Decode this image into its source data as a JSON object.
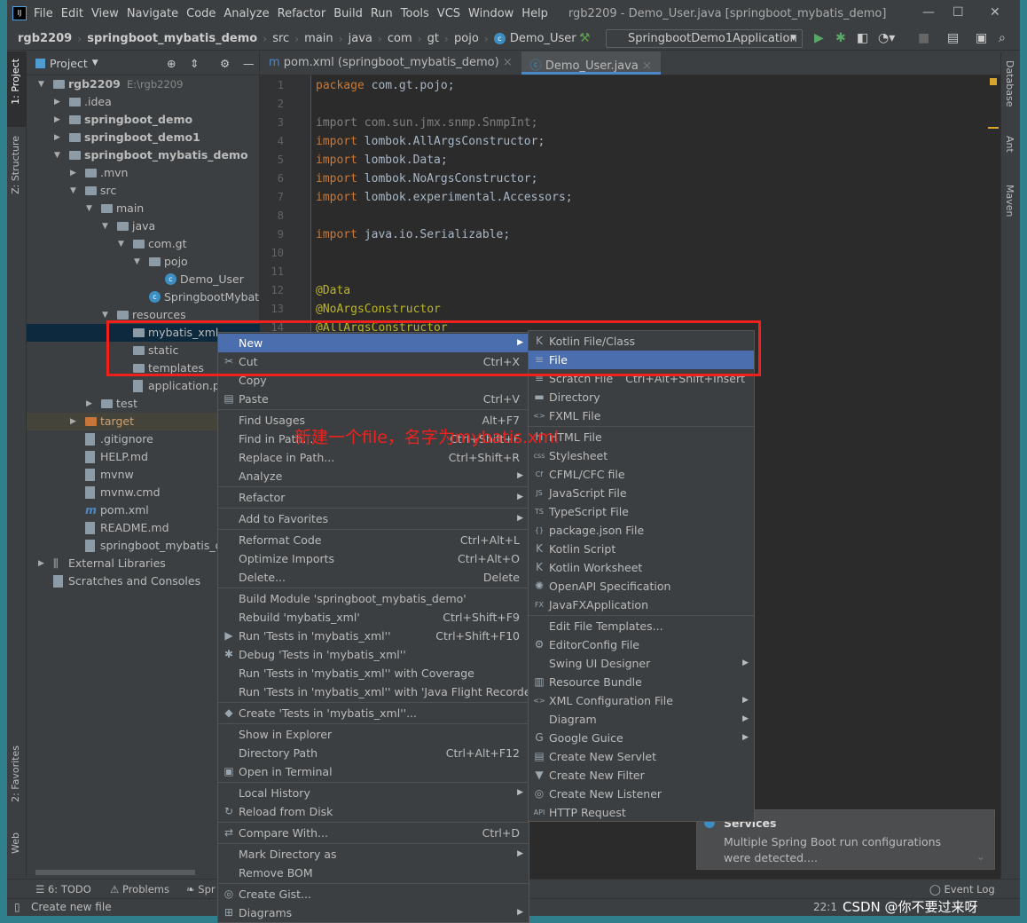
{
  "app": {
    "title": "rgb2209 - Demo_User.java [springboot_mybatis_demo]",
    "logo": "IJ",
    "menu": [
      "File",
      "Edit",
      "View",
      "Navigate",
      "Code",
      "Analyze",
      "Refactor",
      "Build",
      "Run",
      "Tools",
      "VCS",
      "Window",
      "Help"
    ]
  },
  "navbar": {
    "crumbs": [
      "rgb2209",
      "springboot_mybatis_demo",
      "src",
      "main",
      "java",
      "com",
      "gt",
      "pojo",
      "Demo_User"
    ],
    "run_config": "SpringbootDemo1Application"
  },
  "left_strip": [
    "1: Project",
    "Z: Structure",
    "2: Favorites",
    "Web"
  ],
  "right_strip": [
    "Database",
    "Ant",
    "Maven"
  ],
  "project": {
    "title": "Project",
    "tree": [
      {
        "label": "rgb2209",
        "hint": "E:\\rgb2209",
        "level": 0,
        "arrow": "open",
        "icon": "folder",
        "bold": true
      },
      {
        "label": ".idea",
        "level": 1,
        "arrow": "closed",
        "icon": "folder"
      },
      {
        "label": "springboot_demo",
        "level": 1,
        "arrow": "closed",
        "icon": "folder",
        "bold": true
      },
      {
        "label": "springboot_demo1",
        "level": 1,
        "arrow": "closed",
        "icon": "folder",
        "bold": true
      },
      {
        "label": "springboot_mybatis_demo",
        "level": 1,
        "arrow": "open",
        "icon": "folder",
        "bold": true
      },
      {
        "label": ".mvn",
        "level": 2,
        "arrow": "closed",
        "icon": "folder"
      },
      {
        "label": "src",
        "level": 2,
        "arrow": "open",
        "icon": "folder"
      },
      {
        "label": "main",
        "level": 3,
        "arrow": "open",
        "icon": "folder"
      },
      {
        "label": "java",
        "level": 4,
        "arrow": "open",
        "icon": "folder"
      },
      {
        "label": "com.gt",
        "level": 5,
        "arrow": "open",
        "icon": "folder"
      },
      {
        "label": "pojo",
        "level": 6,
        "arrow": "open",
        "icon": "folder"
      },
      {
        "label": "Demo_User",
        "level": 7,
        "icon": "class"
      },
      {
        "label": "SpringbootMybatisD",
        "level": 6,
        "icon": "class"
      },
      {
        "label": "resources",
        "level": 4,
        "arrow": "open",
        "icon": "folder"
      },
      {
        "label": "mybatis_xml",
        "level": 5,
        "icon": "folder",
        "selected": true
      },
      {
        "label": "static",
        "level": 5,
        "icon": "folder"
      },
      {
        "label": "templates",
        "level": 5,
        "icon": "folder"
      },
      {
        "label": "application.pro",
        "level": 5,
        "icon": "file"
      },
      {
        "label": "test",
        "level": 3,
        "arrow": "closed",
        "icon": "folder"
      },
      {
        "label": "target",
        "level": 2,
        "arrow": "closed",
        "icon": "folder-orange",
        "excluded": true
      },
      {
        "label": ".gitignore",
        "level": 2,
        "icon": "file"
      },
      {
        "label": "HELP.md",
        "level": 2,
        "icon": "file"
      },
      {
        "label": "mvnw",
        "level": 2,
        "icon": "file"
      },
      {
        "label": "mvnw.cmd",
        "level": 2,
        "icon": "file"
      },
      {
        "label": "pom.xml",
        "level": 2,
        "icon": "maven"
      },
      {
        "label": "README.md",
        "level": 2,
        "icon": "file"
      },
      {
        "label": "springboot_mybatis_der",
        "level": 2,
        "icon": "file"
      },
      {
        "label": "External Libraries",
        "level": 0,
        "arrow": "closed",
        "icon": "library"
      },
      {
        "label": "Scratches and Consoles",
        "level": 0,
        "icon": "scratch"
      }
    ]
  },
  "editor": {
    "tabs": [
      {
        "label": "pom.xml (springboot_mybatis_demo)",
        "active": false
      },
      {
        "label": "Demo_User.java",
        "active": true
      }
    ],
    "lines": [
      [
        [
          "package",
          "kw"
        ],
        [
          " com.gt.pojo;",
          ""
        ]
      ],
      [],
      [
        [
          "import",
          "gr"
        ],
        [
          " com.sun.jmx.snmp.SnmpInt;",
          "gr"
        ]
      ],
      [
        [
          "import",
          "kw"
        ],
        [
          " lombok.AllArgsConstructor;",
          ""
        ]
      ],
      [
        [
          "import",
          "kw"
        ],
        [
          " lombok.Data;",
          ""
        ]
      ],
      [
        [
          "import",
          "kw"
        ],
        [
          " lombok.NoArgsConstructor;",
          ""
        ]
      ],
      [
        [
          "import",
          "kw"
        ],
        [
          " lombok.experimental.Accessors;",
          ""
        ]
      ],
      [],
      [
        [
          "import",
          "kw"
        ],
        [
          " java.io.Serializable;",
          ""
        ]
      ],
      [],
      [],
      [
        [
          "@Data",
          "an"
        ]
      ],
      [
        [
          "@NoArgsConstructor",
          "an"
        ]
      ],
      [
        [
          "@AllArgsConstructor",
          "an"
        ]
      ]
    ]
  },
  "context_menu": [
    {
      "label": "New",
      "sub": true,
      "hl": true
    },
    {
      "label": "Cut",
      "shortcut": "Ctrl+X",
      "icon": "✂"
    },
    {
      "label": "Copy"
    },
    {
      "label": "Paste",
      "shortcut": "Ctrl+V",
      "icon": "▤"
    },
    {
      "sep": true
    },
    {
      "label": "Find Usages",
      "shortcut": "Alt+F7"
    },
    {
      "label": "Find in Path...",
      "shortcut": "Ctrl+Shift+F"
    },
    {
      "label": "Replace in Path...",
      "shortcut": "Ctrl+Shift+R"
    },
    {
      "label": "Analyze",
      "sub": true
    },
    {
      "sep": true
    },
    {
      "label": "Refactor",
      "sub": true
    },
    {
      "sep": true
    },
    {
      "label": "Add to Favorites",
      "sub": true
    },
    {
      "sep": true
    },
    {
      "label": "Reformat Code",
      "shortcut": "Ctrl+Alt+L"
    },
    {
      "label": "Optimize Imports",
      "shortcut": "Ctrl+Alt+O"
    },
    {
      "label": "Delete...",
      "shortcut": "Delete"
    },
    {
      "sep": true
    },
    {
      "label": "Build Module 'springboot_mybatis_demo'"
    },
    {
      "label": "Rebuild 'mybatis_xml'",
      "shortcut": "Ctrl+Shift+F9"
    },
    {
      "label": "Run 'Tests in 'mybatis_xml''",
      "shortcut": "Ctrl+Shift+F10",
      "icon": "▶"
    },
    {
      "label": "Debug 'Tests in 'mybatis_xml''",
      "icon": "✱"
    },
    {
      "label": "Run 'Tests in 'mybatis_xml'' with Coverage"
    },
    {
      "label": "Run 'Tests in 'mybatis_xml'' with 'Java Flight Recorder'"
    },
    {
      "sep": true
    },
    {
      "label": "Create 'Tests in 'mybatis_xml''...",
      "icon": "◆"
    },
    {
      "sep": true
    },
    {
      "label": "Show in Explorer"
    },
    {
      "label": "Directory Path",
      "shortcut": "Ctrl+Alt+F12"
    },
    {
      "label": "Open in Terminal",
      "icon": "▣"
    },
    {
      "sep": true
    },
    {
      "label": "Local History",
      "sub": true
    },
    {
      "label": "Reload from Disk",
      "icon": "↻"
    },
    {
      "sep": true
    },
    {
      "label": "Compare With...",
      "shortcut": "Ctrl+D",
      "icon": "⇄"
    },
    {
      "sep": true
    },
    {
      "label": "Mark Directory as",
      "sub": true
    },
    {
      "label": "Remove BOM"
    },
    {
      "sep": true
    },
    {
      "label": "Create Gist...",
      "icon": "◎"
    },
    {
      "label": "Diagrams",
      "sub": true,
      "icon": "⊞"
    }
  ],
  "new_submenu": [
    {
      "label": "Kotlin File/Class",
      "icon": "K"
    },
    {
      "label": "File",
      "hl": true,
      "icon": "≡"
    },
    {
      "label": "Scratch File",
      "shortcut": "Ctrl+Alt+Shift+Insert",
      "icon": "≡"
    },
    {
      "label": "Directory",
      "icon": "▬"
    },
    {
      "label": "FXML File",
      "icon": "<>"
    },
    {
      "sep": true
    },
    {
      "label": "HTML File",
      "icon": "H"
    },
    {
      "label": "Stylesheet",
      "icon": "css"
    },
    {
      "label": "CFML/CFC file",
      "icon": "Cf"
    },
    {
      "label": "JavaScript File",
      "icon": "JS"
    },
    {
      "label": "TypeScript File",
      "icon": "TS"
    },
    {
      "label": "package.json File",
      "icon": "{}"
    },
    {
      "label": "Kotlin Script",
      "icon": "K"
    },
    {
      "label": "Kotlin Worksheet",
      "icon": "K"
    },
    {
      "label": "OpenAPI Specification",
      "icon": "✺"
    },
    {
      "label": "JavaFXApplication",
      "icon": "FX"
    },
    {
      "sep": true
    },
    {
      "label": "Edit File Templates..."
    },
    {
      "label": "EditorConfig File",
      "icon": "⚙"
    },
    {
      "label": "Swing UI Designer",
      "sub": true
    },
    {
      "label": "Resource Bundle",
      "icon": "▥"
    },
    {
      "label": "XML Configuration File",
      "sub": true,
      "icon": "<>"
    },
    {
      "label": "Diagram",
      "sub": true
    },
    {
      "label": "Google Guice",
      "sub": true,
      "icon": "G"
    },
    {
      "label": "Create New Servlet",
      "icon": "▤"
    },
    {
      "label": "Create New Filter",
      "icon": "▼"
    },
    {
      "label": "Create New Listener",
      "icon": "◎"
    },
    {
      "label": "HTTP Request",
      "icon": "API"
    }
  ],
  "annotation": "新建一个file，名字为mybatis.xml",
  "notification": {
    "title": "Services",
    "body": "Multiple Spring Boot run configurations were detected...."
  },
  "bottom_tools": [
    "6: TODO",
    "Problems",
    "Spr"
  ],
  "event_log": "Event Log",
  "status": {
    "message": "Create new file",
    "position": "22:1",
    "watermark": "CSDN @你不要过来呀"
  }
}
